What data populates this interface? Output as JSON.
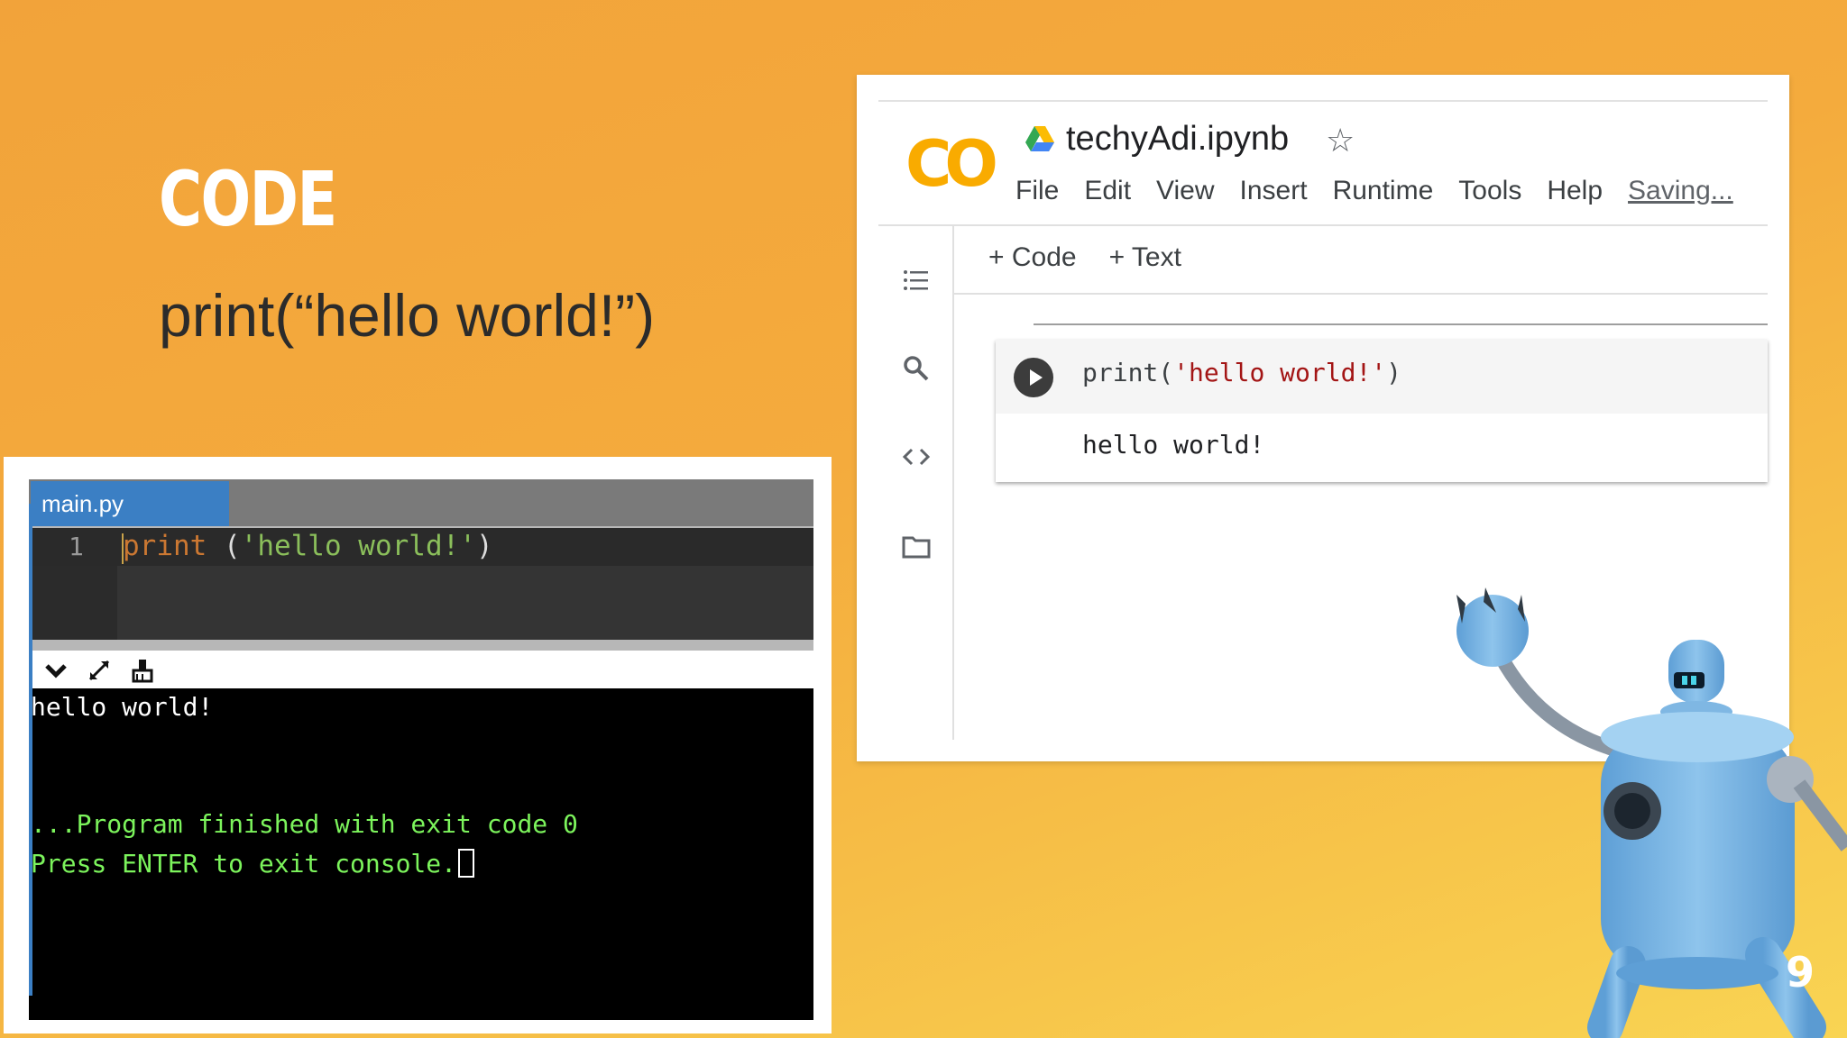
{
  "slide": {
    "heading": "CODE",
    "code_line": "print(“hello world!”)",
    "page_number": "9"
  },
  "ide": {
    "tab_label": "main.py",
    "line_number": "1",
    "code_keyword": "print",
    "code_open": " (",
    "code_string": "'hello world!'",
    "code_close": ")",
    "toolbar_icons": [
      "chevron-down-icon",
      "expand-icon",
      "clear-console-icon"
    ],
    "console_output": "hello world!",
    "console_finished": "...Program finished with exit code 0",
    "console_prompt": "Press ENTER to exit console."
  },
  "colab": {
    "logo_text": "CO",
    "notebook_title": "techyAdi.ipynb",
    "menu": [
      "File",
      "Edit",
      "View",
      "Insert",
      "Runtime",
      "Tools",
      "Help"
    ],
    "status": "Saving...",
    "add_code": "+ Code",
    "add_text": "+ Text",
    "cell_code_prefix": "print(",
    "cell_code_string": "'hello world!'",
    "cell_code_suffix": ")",
    "cell_output": "hello world!",
    "sidebar_icons": [
      "toc-icon",
      "search-icon",
      "code-snippets-icon",
      "folder-icon"
    ]
  },
  "colors": {
    "background": "#f4ab3d",
    "ide_tab": "#3b7fc4",
    "console_green": "#7cf45c",
    "robot_body": "#7fb7e3"
  }
}
